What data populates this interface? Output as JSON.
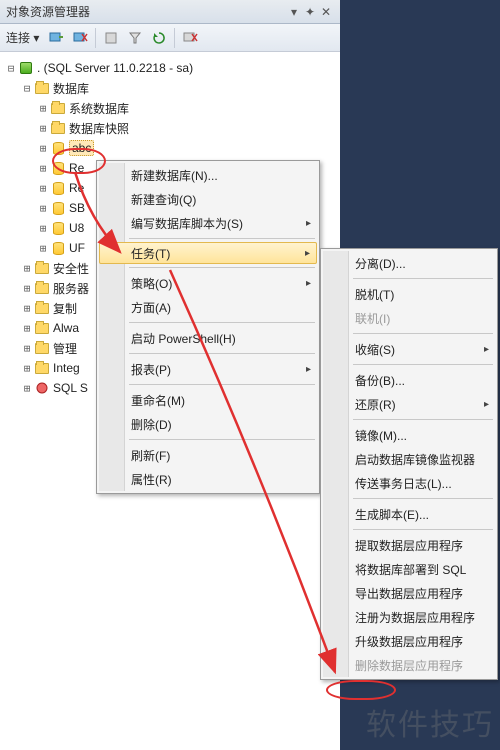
{
  "window": {
    "title": "对象资源管理器",
    "pin_glyph": "▾",
    "pos_glyph": "✦",
    "close_glyph": "✕"
  },
  "toolbar": {
    "connect_label": "连接 ▾"
  },
  "tree": {
    "server_label": ". (SQL Server 11.0.2218 - sa)",
    "db_folder": "数据库",
    "sys_db": "系统数据库",
    "snapshot": "数据库快照",
    "db_items": [
      "abc",
      "Re",
      "Re",
      "SB",
      "U8",
      "UF"
    ],
    "security": "安全性",
    "server_obj": "服务器",
    "replication": "复制",
    "alwayson": "Alwa",
    "management": "管理",
    "integ": "Integ",
    "sqlagent": "SQL S"
  },
  "ctx1": {
    "new_db": "新建数据库(N)...",
    "new_query": "新建查询(Q)",
    "script_db_as": "编写数据库脚本为(S)",
    "tasks": "任务(T)",
    "policies": "策略(O)",
    "facets": "方面(A)",
    "powershell": "启动 PowerShell(H)",
    "reports": "报表(P)",
    "rename": "重命名(M)",
    "delete": "删除(D)",
    "refresh": "刷新(F)",
    "properties": "属性(R)"
  },
  "ctx2": {
    "detach": "分离(D)...",
    "offline": "脱机(T)",
    "online": "联机(I)",
    "shrink": "收缩(S)",
    "backup": "备份(B)...",
    "restore": "还原(R)",
    "mirror": "镜像(M)...",
    "launch_mirror_mon": "启动数据库镜像监视器",
    "ship_logs": "传送事务日志(L)...",
    "gen_scripts": "生成脚本(E)...",
    "extract_dac": "提取数据层应用程序",
    "deploy_db_sql": "将数据库部署到 SQL",
    "export_dac": "导出数据层应用程序",
    "register_dac": "注册为数据层应用程序",
    "upgrade_dac": "升级数据层应用程序",
    "delete_dac": "删除数据层应用程序"
  },
  "watermark": "软件技巧"
}
